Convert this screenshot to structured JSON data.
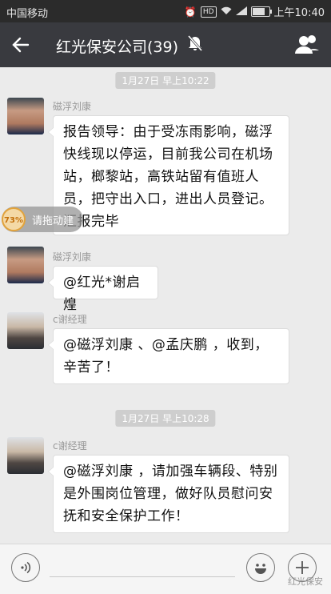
{
  "status_bar": {
    "carrier": "中国移动",
    "time": "上午10:40",
    "hd": "HD"
  },
  "title_bar": {
    "title": "红光保安公司(39)"
  },
  "messages": [
    {
      "type": "time",
      "text": "1月27日 早上10:22"
    },
    {
      "type": "msg",
      "sender": "磁浮刘康",
      "text": "报告领导：由于受冻雨影响，磁浮快线现以停运，目前我公司在机场站，榔黎站，高铁站留有值班人员，把守出入口，进出人员登记。汇报完毕"
    },
    {
      "type": "msg",
      "sender": "磁浮刘康",
      "text": "@红光*谢启煌"
    },
    {
      "type": "msg",
      "sender": "c谢经理",
      "text": "@磁浮刘康 、@孟庆鹏 ，收到，辛苦了！"
    },
    {
      "type": "time",
      "text": "1月27日 早上10:28"
    },
    {
      "type": "msg",
      "sender": "c谢经理",
      "text": "@磁浮刘康 ，请加强车辆段、特别是外围岗位管理，做好队员慰问安抚和安全保护工作！"
    }
  ],
  "floating_widget": {
    "percent": "73%",
    "hint": "请拖动建"
  },
  "watermark": "红光保安"
}
